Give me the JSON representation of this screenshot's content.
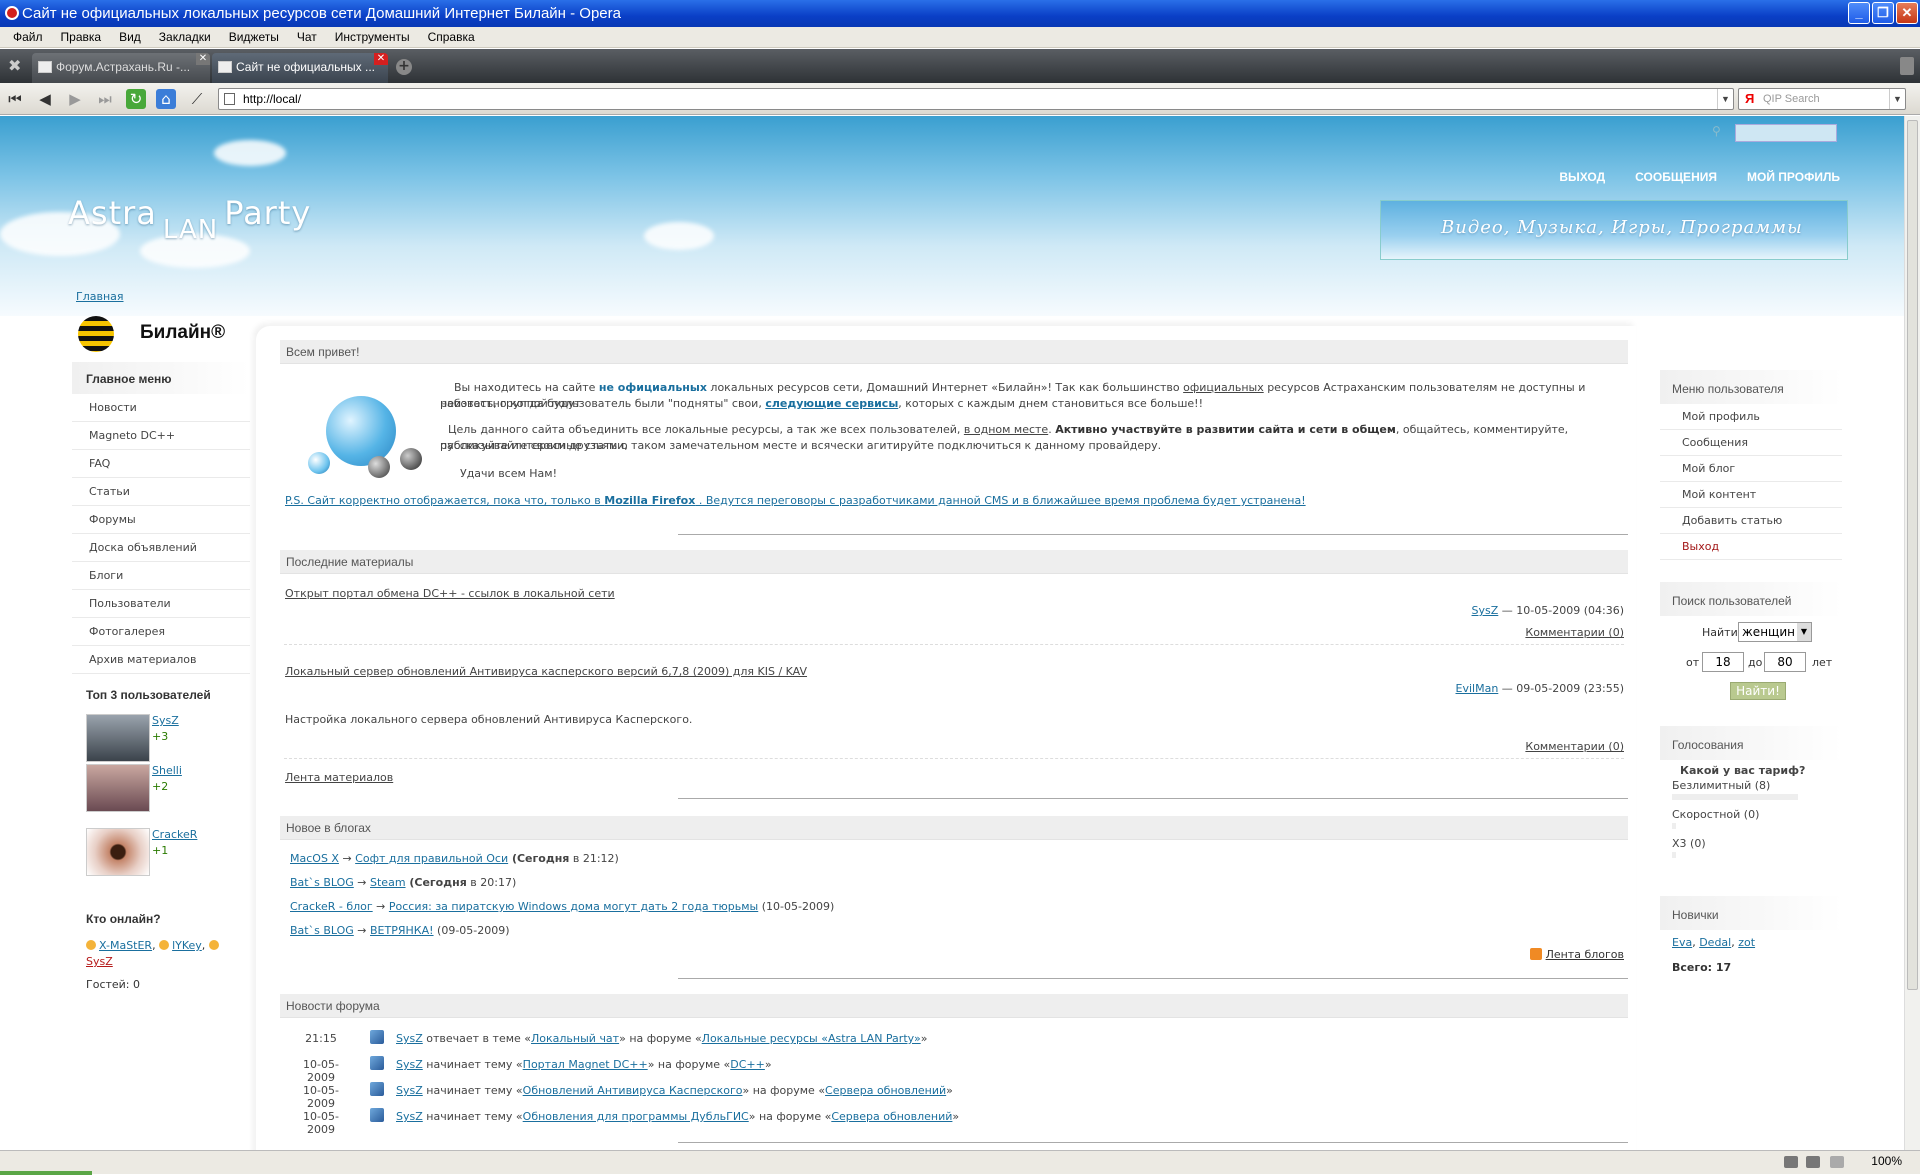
{
  "window": {
    "title": "Сайт не официальных локальных ресурсов сети Домашний Интернет Билайн - Opera",
    "buttons": [
      "_",
      "❐",
      "✕"
    ]
  },
  "menubar": [
    "Файл",
    "Правка",
    "Вид",
    "Закладки",
    "Виджеты",
    "Чат",
    "Инструменты",
    "Справка"
  ],
  "tabs": [
    {
      "label": "Форум.Астрахань.Ru -...",
      "active": false
    },
    {
      "label": "Сайт не официальных ...",
      "active": true
    }
  ],
  "address": {
    "url": "http://local/"
  },
  "search": {
    "placeholder": "QIP Search",
    "engine": "Я"
  },
  "site": {
    "logo_left": "Astra",
    "logo_mid": "LAN",
    "logo_right": "Party",
    "topnav": [
      "ВЫХОД",
      "СООБЩЕНИЯ",
      "МОЙ ПРОФИЛЬ"
    ],
    "banner": "Видео,  Музыка,  Игры,  Программы",
    "breadcrumb": "Главная",
    "brand": "Билайн®"
  },
  "left": {
    "main_menu_title": "Главное меню",
    "menu": [
      "Новости",
      "Magneto DC++",
      "FAQ",
      "Статьи",
      "Форумы",
      "Доска объявлений",
      "Блоги",
      "Пользователи",
      "Фотогалерея",
      "Архив материалов"
    ],
    "top_title": "Топ 3 пользователей",
    "top_users": [
      {
        "name": "SysZ",
        "score": "+3"
      },
      {
        "name": "Shelli",
        "score": "+2"
      },
      {
        "name": "CrackeR",
        "score": "+1"
      }
    ],
    "online_title": "Кто онлайн?",
    "online_users": [
      "X-MaStER",
      "lYKey",
      "SysZ"
    ],
    "guests": "Гостей: 0"
  },
  "center": {
    "welcome_title": "Всем привет!",
    "welcome_p1_a": "Вы находитесь на сайте ",
    "welcome_p1_b": "не официальных",
    "welcome_p1_c": " локальных ресурсов сети, Домашний Интернет «Билайн»! Так как большинство ",
    "welcome_p1_d": "официальных",
    "welcome_p1_e": " ресурсов Астраханским пользователям не доступны и неизвестно когда будут",
    "welcome_p1_f": "работать, группой пользователь были \"подняты\" свои, ",
    "welcome_p1_g": "следующие сервисы",
    "welcome_p1_h": ", которых с каждым днем становиться все больше!!",
    "welcome_p2_a": "Цель данного сайта объединить все локальные ресурсы, а так же всех пользователей, ",
    "welcome_p2_b": "в одном месте",
    "welcome_p2_c": ". ",
    "welcome_p2_d": "Активно участвуйте в развитии сайта и сети в общем",
    "welcome_p2_e": ", общайтесь, комментируйте, публикуйте интересные статьи,",
    "welcome_p2_f": "рассказывайте своим друзьям о таком замечательном месте и всячески агитируйте подключиться к данному провайдеру.",
    "welcome_p3": "Удачи всем Нам!",
    "ps_a": "P.S. Сайт корректно отображается, пока что, только в ",
    "ps_b": "Mozilla Firefox",
    "ps_c": " . Ведутся переговоры с разработчиками данной CMS и в ближайшее время проблема будет устранена!",
    "latest_title": "Последние материалы",
    "articles": [
      {
        "title": "Открыт портал обмена DC++ - ссылок в локальной сети",
        "author": "SysZ",
        "date": " — 10-05-2009 (04:36)",
        "comments": "Комментарии (0)",
        "desc": ""
      },
      {
        "title": "Локальный сервер обновлений Антивируса касперского версий 6,7,8 (2009) для KIS / KAV",
        "author": "EvilMan",
        "date": " — 09-05-2009 (23:55)",
        "comments": "Комментарии (0)",
        "desc": "Настройка локального сервера обновлений Антивируса Касперского."
      }
    ],
    "materials_feed": "Лента материалов",
    "blogs_title": "Новое в блогах",
    "blogs": [
      {
        "blog": "MacOS X",
        "arrow": " → ",
        "post": "Софт для правильной Оси",
        "when_b": " (Сегодня",
        "when": " в 21:12)"
      },
      {
        "blog": "Bat`s BLOG",
        "arrow": " → ",
        "post": "Steam",
        "when_b": " (Сегодня",
        "when": " в 20:17)"
      },
      {
        "blog": "CrackeR - блог",
        "arrow": " → ",
        "post": "Россия: за пиратскую Windows дома могут дать 2 года тюрьмы",
        "when_b": "",
        "when": " (10-05-2009)"
      },
      {
        "blog": "Bat`s BLOG",
        "arrow": " → ",
        "post": "ВЕТРЯНКА!",
        "when_b": "",
        "when": " (09-05-2009)"
      }
    ],
    "blogs_feed": "Лента блогов",
    "forum_title": "Новости форума",
    "forum": [
      {
        "date": "21:15",
        "user": "SysZ",
        "action": " отвечает в теме «",
        "topic": "Локальный чат",
        "mid": "» на форуме «",
        "forum": "Локальные ресурсы «Astra LAN Party»",
        "end": "»"
      },
      {
        "date": "10-05-2009",
        "user": "SysZ",
        "action": " начинает тему «",
        "topic": "Портал Magnet DC++",
        "mid": "» на форуме «",
        "forum": "DC++",
        "end": "»"
      },
      {
        "date": "10-05-2009",
        "user": "SysZ",
        "action": " начинает тему «",
        "topic": "Обновлений Антивируса Касперского",
        "mid": "» на форуме «",
        "forum": "Сервера обновлений",
        "end": "»"
      },
      {
        "date": "10-05-2009",
        "user": "SysZ",
        "action": " начинает тему «",
        "topic": "Обновления для программы ДубльГИС",
        "mid": "» на форуме «",
        "forum": "Сервера обновлений",
        "end": "»"
      }
    ]
  },
  "right": {
    "user_menu_title": "Меню пользователя",
    "user_menu": [
      "Мой профиль",
      "Сообщения",
      "Мой блог",
      "Мой контент",
      "Добавить статью",
      "Выход"
    ],
    "search_title": "Поиск пользователей",
    "find_label": "Найти",
    "find_value": "женщин",
    "from_label": "от",
    "from_value": "18",
    "to_label": "до",
    "to_value": "80",
    "years_label": "лет",
    "find_button": "Найти!",
    "poll_title": "Голосования",
    "poll_question": "Какой у вас тариф?",
    "poll_options": [
      "Безлимитный (8)",
      "Скоростной (0)",
      "X3 (0)"
    ],
    "newbies_title": "Новички",
    "newbies": [
      "Eva",
      "Dedal",
      "zot"
    ],
    "total": "Всего: 17"
  },
  "status": {
    "zoom": "100%"
  }
}
